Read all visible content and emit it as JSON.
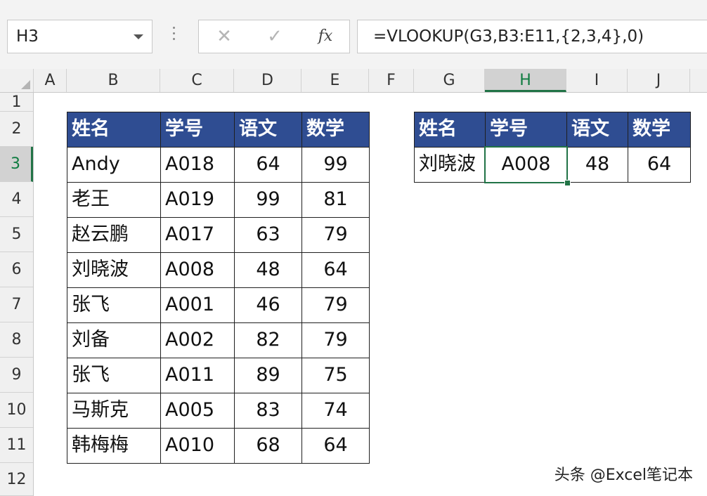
{
  "formula_bar": {
    "name_box": "H3",
    "cancel_symbol": "✕",
    "enter_symbol": "✓",
    "fx_label": "fx",
    "formula": "=VLOOKUP(G3,B3:E11,{2,3,4},0)"
  },
  "columns": [
    "A",
    "B",
    "C",
    "D",
    "E",
    "F",
    "G",
    "H",
    "I",
    "J"
  ],
  "rows": [
    "1",
    "2",
    "3",
    "4",
    "5",
    "6",
    "7",
    "8",
    "9",
    "10",
    "11",
    "12"
  ],
  "active_cell": {
    "column": "H",
    "row": "3"
  },
  "source_table": {
    "headers": [
      "姓名",
      "学号",
      "语文",
      "数学"
    ],
    "rows": [
      [
        "Andy",
        "A018",
        "64",
        "99"
      ],
      [
        "老王",
        "A019",
        "99",
        "81"
      ],
      [
        "赵云鹏",
        "A017",
        "63",
        "79"
      ],
      [
        "刘晓波",
        "A008",
        "48",
        "64"
      ],
      [
        "张飞",
        "A001",
        "46",
        "79"
      ],
      [
        "刘备",
        "A002",
        "82",
        "79"
      ],
      [
        "张飞",
        "A011",
        "89",
        "75"
      ],
      [
        "马斯克",
        "A005",
        "83",
        "74"
      ],
      [
        "韩梅梅",
        "A010",
        "68",
        "64"
      ]
    ]
  },
  "lookup_table": {
    "headers": [
      "姓名",
      "学号",
      "语文",
      "数学"
    ],
    "row": [
      "刘晓波",
      "A008",
      "48",
      "64"
    ]
  },
  "watermark": "头条 @Excel笔记本",
  "colors": {
    "header_fill": "#2f4d92",
    "active_green": "#217346"
  }
}
